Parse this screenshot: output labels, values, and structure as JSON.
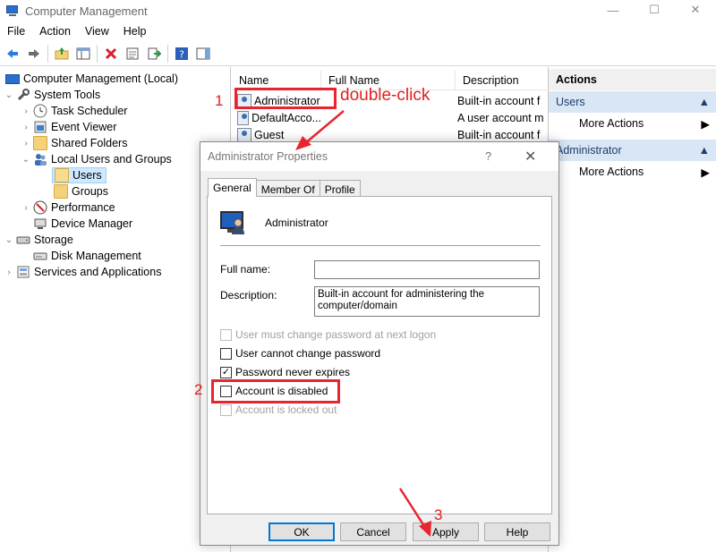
{
  "window": {
    "title": "Computer Management",
    "controls": [
      "—",
      "☐",
      "✕"
    ]
  },
  "menu": [
    "File",
    "Action",
    "View",
    "Help"
  ],
  "toolbar": [
    "back-arrow-icon",
    "forward-arrow-icon",
    "up-folder-icon",
    "show-hide-tree-icon",
    "delete-icon",
    "properties-icon",
    "export-icon",
    "help-icon",
    "show-action-pane-icon"
  ],
  "tree": [
    {
      "label": "Computer Management (Local)",
      "toggle": "",
      "level": 0
    },
    {
      "label": "System Tools",
      "toggle": "⌄",
      "level": 1
    },
    {
      "label": "Task Scheduler",
      "toggle": "›",
      "level": 2
    },
    {
      "label": "Event Viewer",
      "toggle": "›",
      "level": 2
    },
    {
      "label": "Shared Folders",
      "toggle": "›",
      "level": 2
    },
    {
      "label": "Local Users and Groups",
      "toggle": "⌄",
      "level": 2
    },
    {
      "label": "Users",
      "toggle": "",
      "level": 3,
      "selected": true
    },
    {
      "label": "Groups",
      "toggle": "",
      "level": 3
    },
    {
      "label": "Performance",
      "toggle": "›",
      "level": 2
    },
    {
      "label": "Device Manager",
      "toggle": "",
      "level": 2
    },
    {
      "label": "Storage",
      "toggle": "⌄",
      "level": 1
    },
    {
      "label": "Disk Management",
      "toggle": "",
      "level": 2
    },
    {
      "label": "Services and Applications",
      "toggle": "›",
      "level": 1
    }
  ],
  "list": {
    "columns": [
      "Name",
      "Full Name",
      "Description"
    ],
    "rows": [
      {
        "name": "Administrator",
        "full_name": "",
        "description": "Built-in account f"
      },
      {
        "name": "DefaultAcco...",
        "full_name": "",
        "description": "A user account m"
      },
      {
        "name": "Guest",
        "full_name": "",
        "description": "Built-in account f"
      }
    ]
  },
  "actions": {
    "title": "Actions",
    "sections": [
      {
        "label": "Users",
        "item": "More Actions"
      },
      {
        "label": "Administrator",
        "item": "More Actions"
      }
    ]
  },
  "dialog": {
    "title": "Administrator Properties",
    "help": "?",
    "close": "✕",
    "tabs": [
      "General",
      "Member Of",
      "Profile"
    ],
    "active_tab": "General",
    "user_name": "Administrator",
    "full_name_label": "Full name:",
    "full_name_value": "",
    "description_label": "Description:",
    "description_value": "Built-in account for administering the computer/domain",
    "checkboxes": [
      {
        "label": "User must change password at next logon",
        "checked": false,
        "disabled": true
      },
      {
        "label": "User cannot change password",
        "checked": false,
        "disabled": false
      },
      {
        "label": "Password never expires",
        "checked": true,
        "disabled": false
      },
      {
        "label": "Account is disabled",
        "checked": false,
        "disabled": false
      },
      {
        "label": "Account is locked out",
        "checked": false,
        "disabled": true
      }
    ],
    "buttons": [
      "OK",
      "Cancel",
      "Apply",
      "Help"
    ]
  },
  "annotations": {
    "step1": "1",
    "step1_text": "double-click",
    "step2": "2",
    "step3": "3",
    "color": "#e8242e"
  }
}
